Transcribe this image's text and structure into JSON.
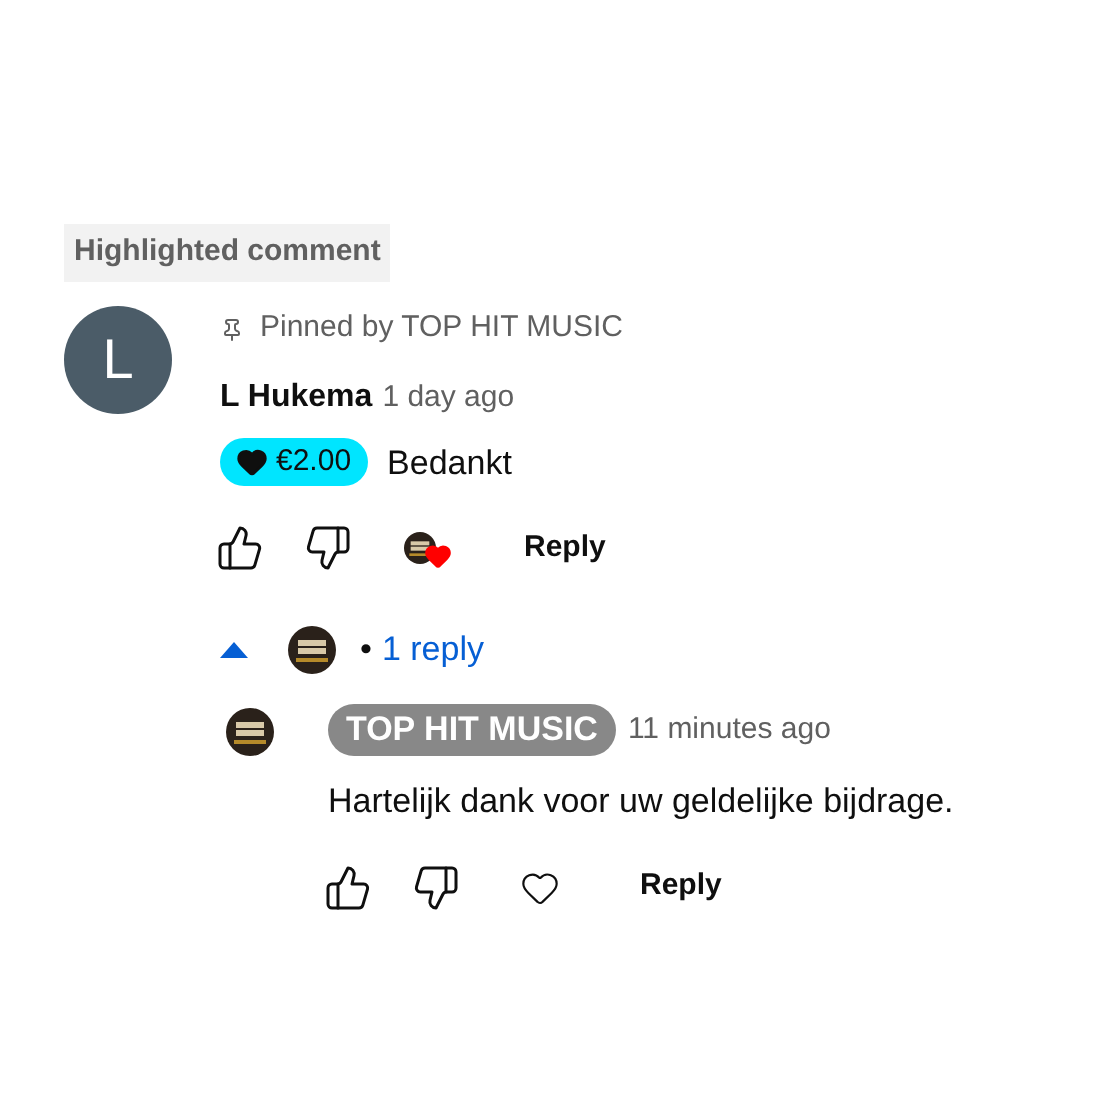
{
  "badge": "Highlighted comment",
  "comment": {
    "avatar_letter": "L",
    "pinned_by": "Pinned by TOP HIT MUSIC",
    "author": "L Hukema",
    "time": "1 day ago",
    "donation": "€2.00",
    "text": "Bedankt",
    "hearted": true,
    "reply_button": "Reply"
  },
  "replies_toggle": {
    "expanded": true,
    "separator": "•",
    "label": "1 reply"
  },
  "replies": [
    {
      "author": "TOP HIT MUSIC",
      "time": "11 minutes ago",
      "text": "Hartelijk dank voor uw geldelijke bijdrage.",
      "hearted": false,
      "reply_button": "Reply"
    }
  ]
}
